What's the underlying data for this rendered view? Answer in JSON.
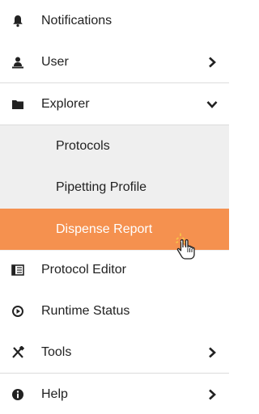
{
  "menu": {
    "notifications": {
      "label": "Notifications",
      "icon": "bell-icon"
    },
    "user": {
      "label": "User",
      "icon": "user-icon",
      "chevron": "chevron-right-icon"
    },
    "explorer": {
      "label": "Explorer",
      "icon": "folder-icon",
      "chevron": "chevron-down-icon",
      "children": [
        {
          "label": "Protocols"
        },
        {
          "label": "Pipetting Profile"
        },
        {
          "label": "Dispense Report",
          "active": true
        }
      ]
    },
    "protocol_editor": {
      "label": "Protocol Editor",
      "icon": "editor-icon"
    },
    "runtime_status": {
      "label": "Runtime Status",
      "icon": "status-icon"
    },
    "tools": {
      "label": "Tools",
      "icon": "tools-icon",
      "chevron": "chevron-right-icon"
    },
    "help": {
      "label": "Help",
      "icon": "info-icon",
      "chevron": "chevron-right-icon"
    }
  },
  "colors": {
    "active_bg": "#f5914f",
    "submenu_bg": "#efefef",
    "text": "#222222",
    "divider": "#dcdcdc"
  }
}
